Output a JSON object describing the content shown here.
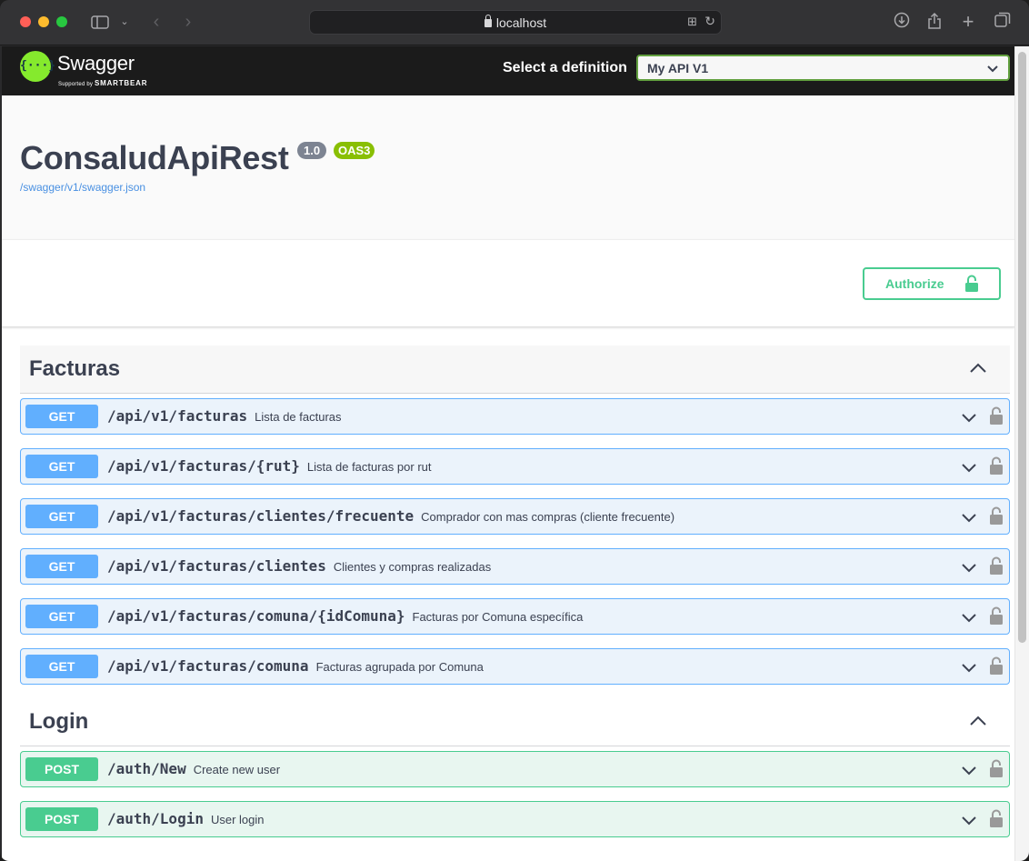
{
  "browser": {
    "url": "localhost"
  },
  "swagger": {
    "logo_text": "Swagger",
    "logo_supported_by": "Supported by",
    "logo_company": "SMARTBEAR",
    "definition_label": "Select a definition",
    "definition_value": "My API V1"
  },
  "info": {
    "title": "ConsaludApiRest",
    "version": "1.0",
    "oas_badge": "OAS3",
    "spec_url": "/swagger/v1/swagger.json"
  },
  "authorize_label": "Authorize",
  "tags": [
    {
      "name": "Facturas",
      "operations": [
        {
          "method": "GET",
          "path": "/api/v1/facturas",
          "summary": "Lista de facturas"
        },
        {
          "method": "GET",
          "path": "/api/v1/facturas/{rut}",
          "summary": "Lista de facturas por rut"
        },
        {
          "method": "GET",
          "path": "/api/v1/facturas/clientes/frecuente",
          "summary": "Comprador con mas compras (cliente frecuente)"
        },
        {
          "method": "GET",
          "path": "/api/v1/facturas/clientes",
          "summary": "Clientes y compras realizadas"
        },
        {
          "method": "GET",
          "path": "/api/v1/facturas/comuna/{idComuna}",
          "summary": "Facturas por Comuna específica"
        },
        {
          "method": "GET",
          "path": "/api/v1/facturas/comuna",
          "summary": "Facturas agrupada por Comuna"
        }
      ]
    },
    {
      "name": "Login",
      "operations": [
        {
          "method": "POST",
          "path": "/auth/New",
          "summary": "Create new user"
        },
        {
          "method": "POST",
          "path": "/auth/Login",
          "summary": "User login"
        }
      ]
    }
  ]
}
